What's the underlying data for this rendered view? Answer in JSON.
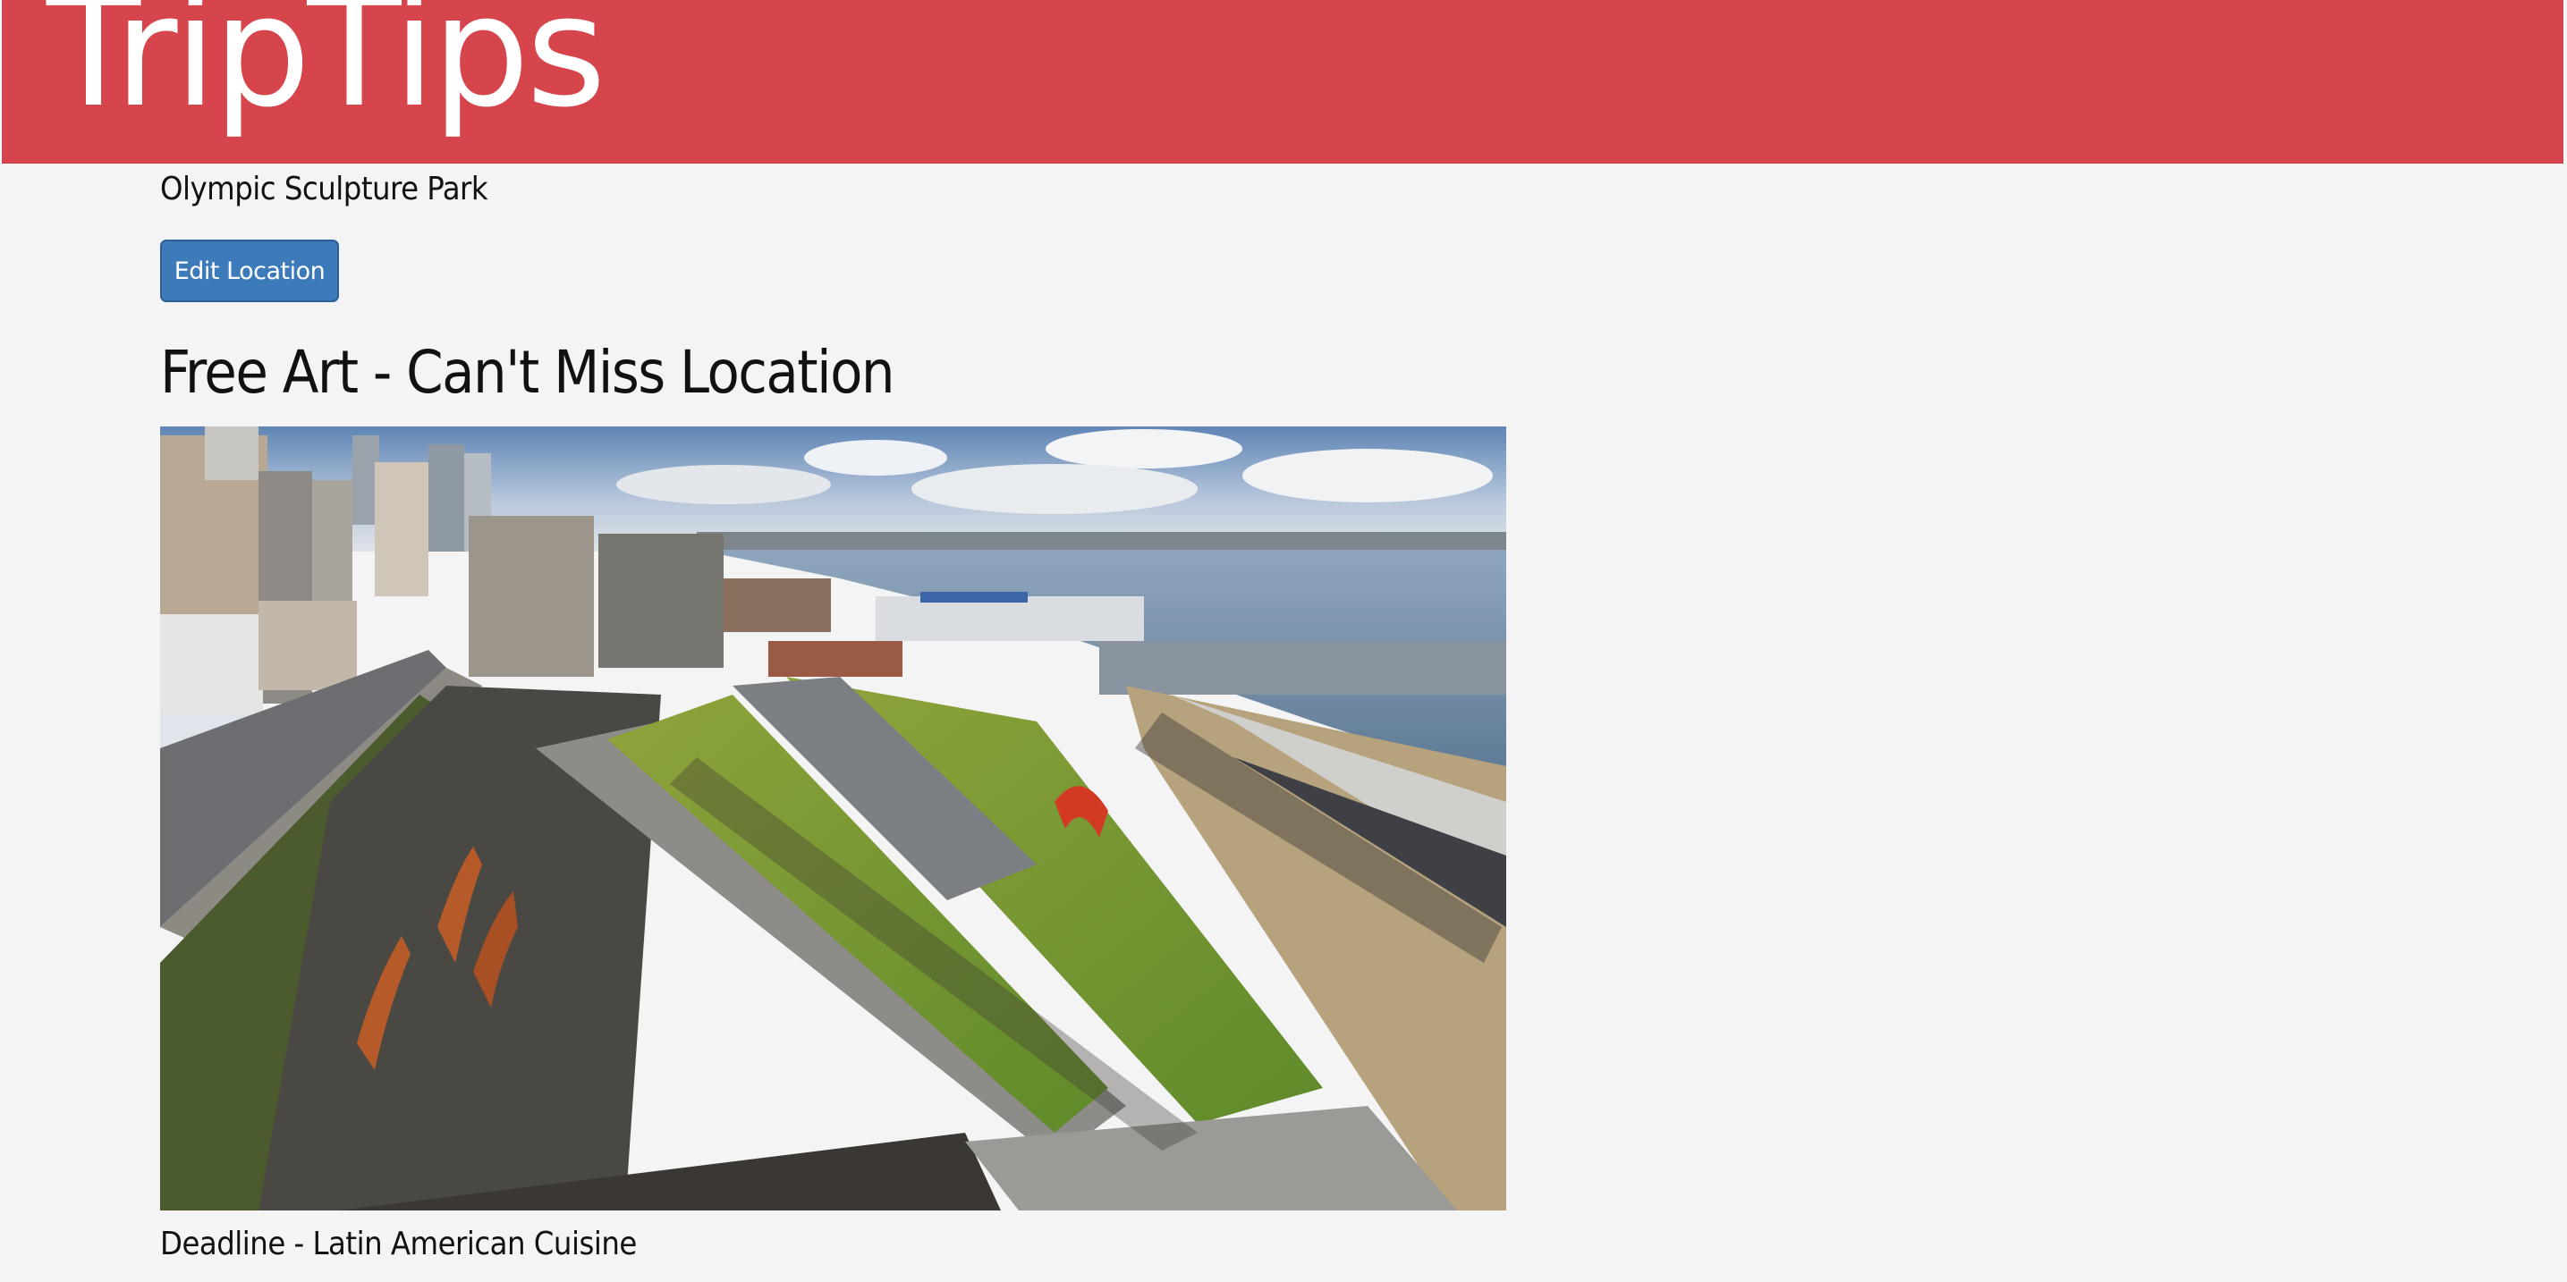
{
  "header": {
    "logo_text": "TripTips",
    "background_color": "#d6454b"
  },
  "location": {
    "name": "Olympic Sculpture Park",
    "edit_button_label": "Edit Location",
    "tip_title": "Free Art - Can't Miss Location",
    "photo_description": "aerial-photo-olympic-sculpture-park-seattle"
  },
  "next_location": {
    "title": "Deadline - Latin American Cuisine"
  },
  "colors": {
    "button": "#3c7ab9",
    "page_background": "#f4f4f4"
  }
}
